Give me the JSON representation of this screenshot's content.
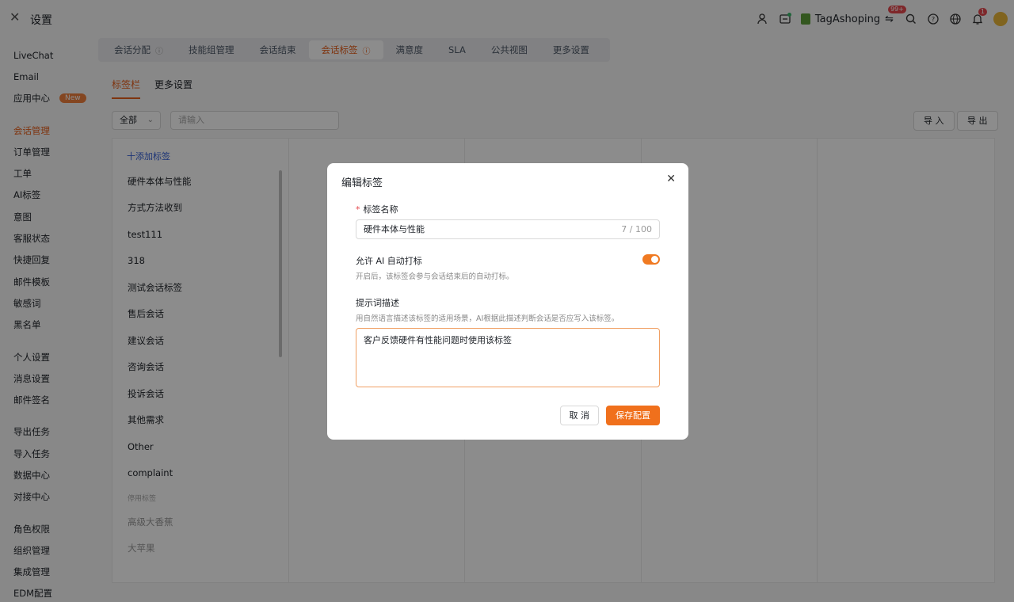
{
  "header": {
    "title": "设置",
    "shop_name": "TagAshoping",
    "message_badge": "99+",
    "notification_badge": "1"
  },
  "sidebar": {
    "groups": [
      [
        {
          "label": "LiveChat"
        },
        {
          "label": "Email"
        },
        {
          "label": "应用中心",
          "badge": "New"
        }
      ],
      [
        {
          "label": "会话管理",
          "active": true
        },
        {
          "label": "订单管理"
        },
        {
          "label": "工单"
        },
        {
          "label": "AI标签"
        },
        {
          "label": "意图"
        },
        {
          "label": "客服状态"
        },
        {
          "label": "快捷回复"
        },
        {
          "label": "邮件模板"
        },
        {
          "label": "敏感词"
        },
        {
          "label": "黑名单"
        }
      ],
      [
        {
          "label": "个人设置"
        },
        {
          "label": "消息设置"
        },
        {
          "label": "邮件签名"
        }
      ],
      [
        {
          "label": "导出任务"
        },
        {
          "label": "导入任务"
        },
        {
          "label": "数据中心"
        },
        {
          "label": "对接中心"
        }
      ],
      [
        {
          "label": "角色权限"
        },
        {
          "label": "组织管理"
        },
        {
          "label": "集成管理"
        },
        {
          "label": "EDM配置"
        }
      ]
    ]
  },
  "tabs": [
    {
      "label": "会话分配",
      "info": true
    },
    {
      "label": "技能组管理"
    },
    {
      "label": "会话结束"
    },
    {
      "label": "会话标签",
      "info": true,
      "active": true
    },
    {
      "label": "满意度"
    },
    {
      "label": "SLA"
    },
    {
      "label": "公共视图"
    },
    {
      "label": "更多设置"
    }
  ],
  "subtabs": [
    {
      "label": "标签栏",
      "active": true
    },
    {
      "label": "更多设置"
    }
  ],
  "filter": {
    "select_value": "全部",
    "search_placeholder": "请输入",
    "import_label": "导 入",
    "export_label": "导 出"
  },
  "tag_board": {
    "add_label": "十添加标签",
    "tags": [
      "硬件本体与性能",
      "方式方法收到",
      "test111",
      "318",
      "测试会话标签",
      "售后会话",
      "建议会话",
      "咨询会话",
      "投诉会话",
      "其他需求",
      "Other",
      "complaint"
    ],
    "disabled_section": "停用标签",
    "disabled_tags": [
      "高级大香蕉",
      "大苹果"
    ]
  },
  "modal": {
    "title": "编辑标签",
    "name_label": "标签名称",
    "name_value": "硬件本体与性能",
    "name_count": "7 / 100",
    "ai_label": "允许 AI 自动打标",
    "ai_hint": "开启后，该标签会参与会话结束后的自动打标。",
    "ai_enabled": true,
    "prompt_label": "提示词描述",
    "prompt_hint": "用自然语言描述该标签的适用场景，AI根据此描述判断会话是否应写入该标签。",
    "prompt_value": "客户反馈硬件有性能问题时使用该标签",
    "cancel_label": "取 消",
    "save_label": "保存配置"
  },
  "colors": {
    "accent": "#e8601c",
    "link": "#3460d8",
    "overlay": "rgba(0,0,0,0.45)"
  }
}
